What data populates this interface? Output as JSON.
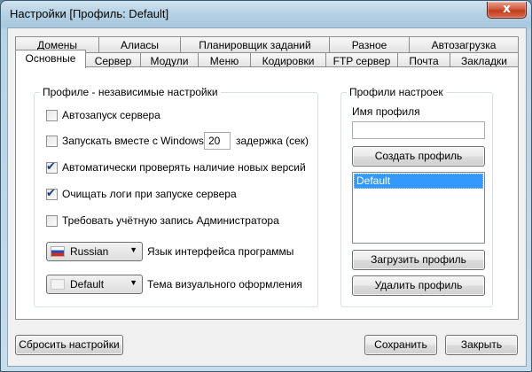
{
  "window": {
    "title": "Настройки [Профиль: Default]",
    "close_glyph": "x"
  },
  "tabs_row1": [
    "Домены",
    "Алиасы",
    "Планировщик заданий",
    "Разное",
    "Автозагрузка"
  ],
  "tabs_row2": [
    "Основные",
    "Сервер",
    "Модули",
    "Меню",
    "Кодировки",
    "FTP сервер",
    "Почта",
    "Закладки"
  ],
  "active_tab": "Основные",
  "general": {
    "legend": "Профиле - независимые настройки",
    "autostart": {
      "label": "Автозапуск сервера",
      "checked": false
    },
    "run_with_windows": {
      "label": "Запускать вместе с Windows",
      "checked": false,
      "delay_value": "20",
      "delay_label": "задержка (сек)"
    },
    "check_updates": {
      "label": "Автоматически проверять наличие новых версий",
      "checked": true
    },
    "clear_logs": {
      "label": "Очищать логи при запуске сервера",
      "checked": true
    },
    "require_admin": {
      "label": "Требовать учётную запись Администратора",
      "checked": false
    },
    "language": {
      "value": "Russian",
      "label": "Язык интерфейса программы",
      "icon": "russia-flag-icon"
    },
    "theme": {
      "value": "Default",
      "label": "Тема визуального оформления"
    }
  },
  "profiles": {
    "legend": "Профили настроек",
    "name_label": "Имя профиля",
    "name_value": "",
    "create_label": "Создать профиль",
    "list": [
      "Default"
    ],
    "load_label": "Загрузить профиль",
    "delete_label": "Удалить профиль"
  },
  "footer": {
    "reset_label": "Сбросить настройки",
    "save_label": "Сохранить",
    "close_label": "Закрыть"
  },
  "colors": {
    "selection": "#3399ff",
    "close_button": "#c8452a",
    "frame": "#a9c8de"
  }
}
